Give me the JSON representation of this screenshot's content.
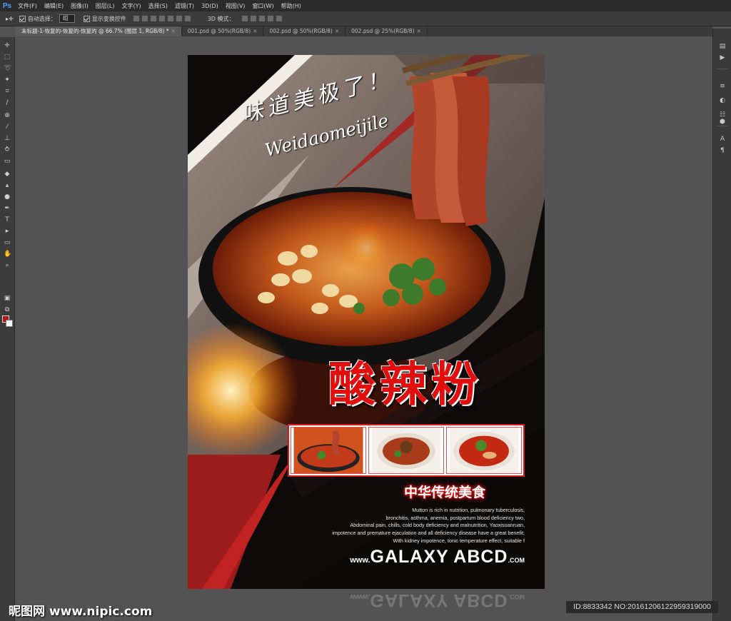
{
  "app": {
    "logo": "Ps"
  },
  "menu": [
    "文件(F)",
    "编辑(E)",
    "图像(I)",
    "图层(L)",
    "文字(Y)",
    "选择(S)",
    "滤镜(T)",
    "3D(D)",
    "视图(V)",
    "窗口(W)",
    "帮助(H)"
  ],
  "options_bar": {
    "auto_select_label": "自动选择：",
    "auto_select_value": "组",
    "show_transform_label": "显示变换控件",
    "mode_3d_label": "3D 模式："
  },
  "tabs": [
    {
      "label": "未标题-1-恢复的-恢复的-恢复的 @ 66.7% (图层 1, RGB/8) *",
      "active": true
    },
    {
      "label": "001.psd @ 50%(RGB/8)",
      "active": false
    },
    {
      "label": "002.psd @ 50%(RGB/8)",
      "active": false
    },
    {
      "label": "002.psd @ 25%(RGB/8)",
      "active": false
    }
  ],
  "tab_close_glyph": "×",
  "tools": [
    "move-icon",
    "marquee-icon",
    "lasso-icon",
    "quick-select-icon",
    "crop-icon",
    "eyedropper-icon",
    "healing-brush-icon",
    "brush-icon",
    "clone-stamp-icon",
    "history-brush-icon",
    "eraser-icon",
    "paint-bucket-icon",
    "blur-icon",
    "dodge-icon",
    "pen-icon",
    "type-icon",
    "path-select-icon",
    "shape-icon",
    "hand-icon",
    "zoom-icon"
  ],
  "colors": {
    "foreground": "#b01515",
    "background": "#ffffff",
    "title_red": "#e20d0d",
    "accent_red": "#d41a1a"
  },
  "poster": {
    "slogan": "味道美极了！",
    "slogan_pinyin": "Weidaomeijile",
    "title": "酸辣粉",
    "subtitle": "中华传统美食",
    "description": [
      "Mutton is rich in nutrition, pulmonary tuberculosis,",
      "bronchitis, asthma, anemia, postpartum blood deficiency two,",
      "Abdominal pain, chills, cold body deficiency and malnutrition, Yaoxisuanruan,",
      "impotence and premature ejaculation and all deficiency disease have a great benefit;",
      "With kidney impotence, tonic temperature effect, suitable f"
    ],
    "brand": {
      "prefix": "www.",
      "name": "GALAXY ABCD",
      "suffix": ".COM"
    }
  },
  "watermark": {
    "left": "昵图网 www.nipic.com",
    "right": "ID:8833342 NO:20161206122959319000"
  }
}
